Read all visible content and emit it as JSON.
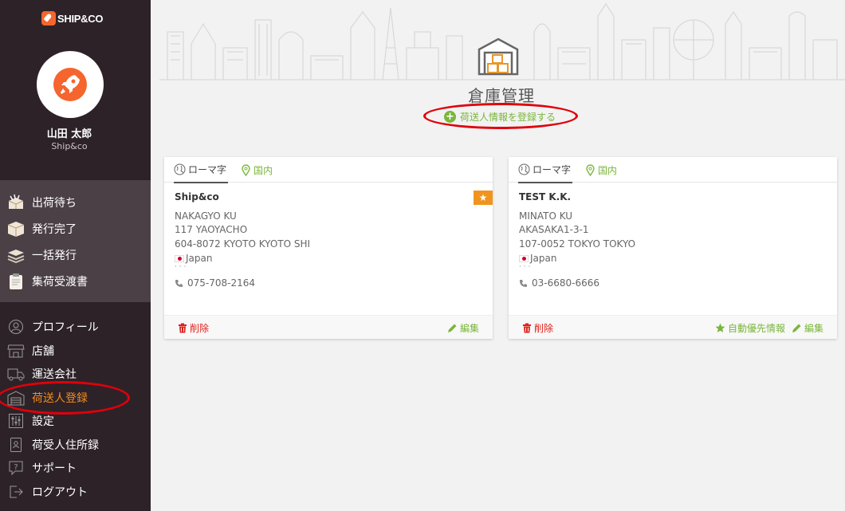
{
  "app": {
    "logo_text": "SHIP&CO"
  },
  "user": {
    "name": "山田 太郎",
    "company": "Ship&co"
  },
  "nav_primary": [
    {
      "label": "出荷待ち",
      "icon": "open-box-icon"
    },
    {
      "label": "発行完了",
      "icon": "closed-box-icon"
    },
    {
      "label": "一括発行",
      "icon": "stack-icon"
    },
    {
      "label": "集荷受渡書",
      "icon": "clipboard-icon"
    }
  ],
  "nav_secondary": [
    {
      "label": "プロフィール",
      "icon": "person-icon"
    },
    {
      "label": "店舗",
      "icon": "store-icon"
    },
    {
      "label": "運送会社",
      "icon": "truck-icon"
    },
    {
      "label": "荷送人登録",
      "icon": "warehouse-icon",
      "active": true
    },
    {
      "label": "設定",
      "icon": "sliders-icon"
    },
    {
      "label": "荷受人住所録",
      "icon": "address-book-icon"
    },
    {
      "label": "サポート",
      "icon": "help-icon"
    },
    {
      "label": "ログアウト",
      "icon": "logout-icon"
    }
  ],
  "page": {
    "title": "倉庫管理",
    "add_label": "荷送人情報を登録する"
  },
  "cards": [
    {
      "tab_romaji": "ローマ字",
      "tab_domestic": "国内",
      "name": "Ship&co",
      "is_default": true,
      "address_lines": [
        "NAKAGYO KU",
        "117 YAOYACHO",
        "604-8072 KYOTO KYOTO SHI"
      ],
      "country": "Japan",
      "dots": "· · ·",
      "phone": "075-708-2164",
      "delete_label": "削除",
      "edit_label": "編集"
    },
    {
      "tab_romaji": "ローマ字",
      "tab_domestic": "国内",
      "name": "TEST K.K.",
      "is_default": false,
      "address_lines": [
        "MINATO KU",
        "AKASAKA1-3-1",
        "107-0052 TOKYO TOKYO"
      ],
      "country": "Japan",
      "dots": "· · ·",
      "phone": "03-6680-6666",
      "delete_label": "削除",
      "default_label": "自動優先情報",
      "edit_label": "編集"
    }
  ],
  "colors": {
    "sidebar_bg": "#2d2228",
    "sidebar_section_bg": "#4b4046",
    "accent_green": "#7ab63a",
    "accent_orange": "#f28c1e",
    "danger_red": "#e0201b",
    "annotation_red": "#e0000b"
  }
}
